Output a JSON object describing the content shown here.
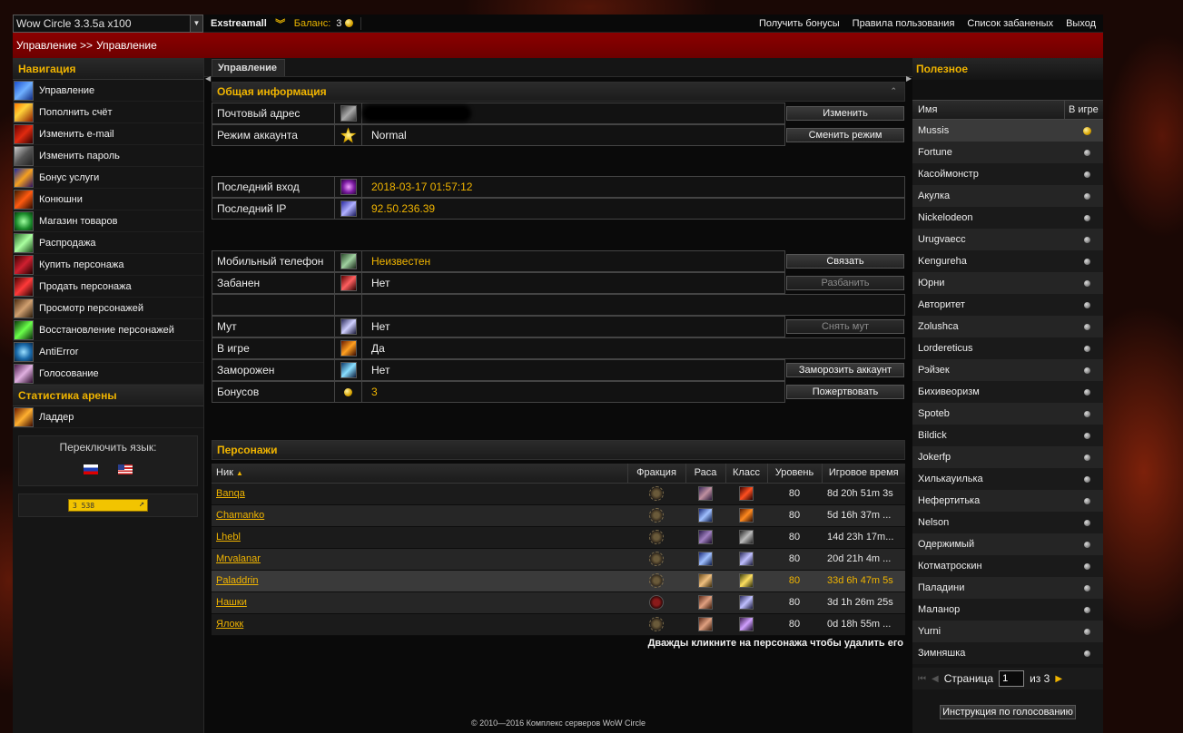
{
  "topbar": {
    "server": "Wow Circle 3.3.5a x100",
    "username": "Exstreamall",
    "balance_label": "Баланс:",
    "balance_value": "3",
    "links": [
      "Получить бонусы",
      "Правила пользования",
      "Список забаненых",
      "Выход"
    ]
  },
  "breadcrumb": {
    "first": "Управление >>",
    "second": "Управление"
  },
  "left": {
    "nav_title": "Навигация",
    "nav": [
      {
        "label": "Управление",
        "icon": "management-icon"
      },
      {
        "label": "Пополнить счёт",
        "icon": "deposit-icon"
      },
      {
        "label": "Изменить e-mail",
        "icon": "email-icon"
      },
      {
        "label": "Изменить пароль",
        "icon": "password-icon"
      },
      {
        "label": "Бонус услуги",
        "icon": "bonus-icon"
      },
      {
        "label": "Конюшни",
        "icon": "stables-icon"
      },
      {
        "label": "Магазин товаров",
        "icon": "shop-icon"
      },
      {
        "label": "Распродажа",
        "icon": "sale-icon"
      },
      {
        "label": "Купить персонажа",
        "icon": "buy-character-icon"
      },
      {
        "label": "Продать персонажа",
        "icon": "sell-character-icon"
      },
      {
        "label": "Просмотр персонажей",
        "icon": "view-characters-icon"
      },
      {
        "label": "Восстановление персонажей",
        "icon": "restore-characters-icon"
      },
      {
        "label": "AntiError",
        "icon": "antierror-icon"
      },
      {
        "label": "Голосование",
        "icon": "vote-icon"
      }
    ],
    "arena_title": "Статистика арены",
    "arena": [
      {
        "label": "Ладдер",
        "icon": "ladder-icon"
      }
    ],
    "lang_title": "Переключить язык:",
    "counter_text": "3 538"
  },
  "center": {
    "tab": "Управление",
    "general_title": "Общая информация",
    "rows": {
      "email": {
        "label": "Почтовый адрес",
        "value": "",
        "button": "Изменить"
      },
      "mode": {
        "label": "Режим аккаунта",
        "value": "Normal",
        "button": "Сменить режим"
      },
      "last_login": {
        "label": "Последний вход",
        "value": "2018-03-17 01:57:12"
      },
      "last_ip": {
        "label": "Последний IP",
        "value": "92.50.236.39"
      },
      "phone": {
        "label": "Мобильный телефон",
        "value": "Неизвестен",
        "button": "Связать"
      },
      "banned": {
        "label": "Забанен",
        "value": "Нет",
        "button": "Разбанить"
      },
      "mute": {
        "label": "Мут",
        "value": "Нет",
        "button": "Снять мут"
      },
      "ingame": {
        "label": "В игре",
        "value": "Да"
      },
      "frozen": {
        "label": "Заморожен",
        "value": "Нет",
        "button": "Заморозить аккаунт"
      },
      "bonuses": {
        "label": "Бонусов",
        "value": "3",
        "button": "Пожертвовать"
      }
    },
    "chars_title": "Персонажи",
    "chars_headers": [
      "Ник",
      "Фракция",
      "Раса",
      "Класс",
      "Уровень",
      "Игровое время"
    ],
    "chars": [
      {
        "nick": "Banqa",
        "faction": "alliance",
        "race": "r1",
        "cls": "cl1",
        "level": "80",
        "time": "8d 20h 51m 3s"
      },
      {
        "nick": "Chamanko",
        "faction": "alliance",
        "race": "r2",
        "cls": "cl2",
        "level": "80",
        "time": "5d 16h 37m ..."
      },
      {
        "nick": "Lhebl",
        "faction": "alliance",
        "race": "r3",
        "cls": "cl3",
        "level": "80",
        "time": "14d 23h 17m..."
      },
      {
        "nick": "Mrvalanar",
        "faction": "alliance",
        "race": "r2",
        "cls": "cl4",
        "level": "80",
        "time": "20d 21h 4m ..."
      },
      {
        "nick": "Paladdrin",
        "faction": "alliance",
        "race": "r4",
        "cls": "cl5",
        "level": "80",
        "time": "33d 6h 47m 5s"
      },
      {
        "nick": "Нашки",
        "faction": "horde",
        "race": "r5",
        "cls": "cl4",
        "level": "80",
        "time": "3d 1h 26m 25s"
      },
      {
        "nick": "Ялокк",
        "faction": "alliance",
        "race": "r5",
        "cls": "cl6",
        "level": "80",
        "time": "0d 18h 55m ..."
      }
    ],
    "chars_note": "Дважды кликните на персонажа чтобы удалить его"
  },
  "right": {
    "title": "Полезное",
    "col_name": "Имя",
    "col_ingame": "В игре",
    "players": [
      "Mussis",
      "Fortune",
      "Касоймонстр",
      "Акулка",
      "Nickelodeon",
      "Urugvaecc",
      "Kengureha",
      "Юрни",
      "Авторитет",
      "Zolushca",
      "Lordereticus",
      "Рэйзек",
      "Бихивеоризм",
      "Spoteb",
      "Bildick",
      "Jokerfp",
      "Хилькауилька",
      "Нефертитька",
      "Nelson",
      "Одержимый",
      "Котматроскин",
      "Паладини",
      "Маланор",
      "Yurni",
      "Зимняшка"
    ],
    "pager": {
      "label": "Страница",
      "current": "1",
      "of": "из 3"
    },
    "vote_button": "Инструкция по голосованию"
  },
  "footer": "© 2010—2016 Комплекс серверов WoW Circle"
}
